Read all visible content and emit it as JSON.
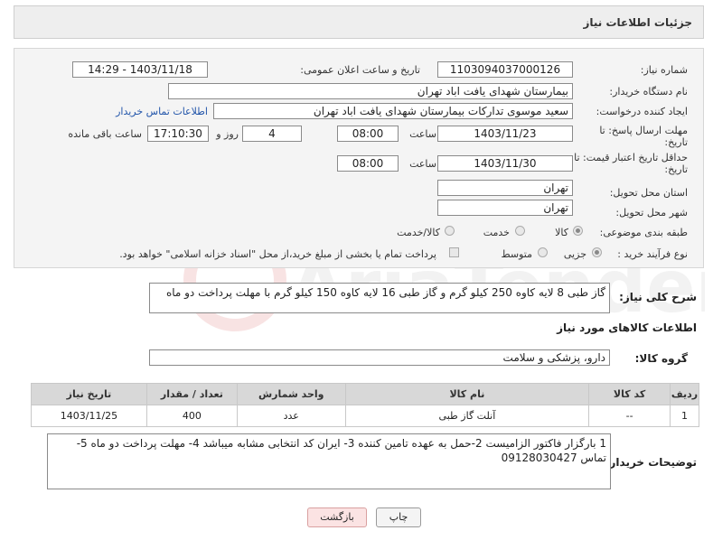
{
  "header": {
    "title": "جزئیات اطلاعات نیاز"
  },
  "form": {
    "need_number": {
      "label": "شماره نیاز:",
      "value": "1103094037000126"
    },
    "announce_datetime": {
      "label": "تاریخ و ساعت اعلان عمومی:",
      "value": "1403/11/18 - 14:29"
    },
    "buyer_org": {
      "label": "نام دستگاه خریدار:",
      "value": "بیمارستان شهدای یافت اباد تهران"
    },
    "requester": {
      "label": "ایجاد کننده درخواست:",
      "value": "سعید موسوی تدارکات بیمارستان شهدای یافت اباد تهران",
      "contact_link": "اطلاعات تماس خریدار"
    },
    "reply_deadline": {
      "label_line1": "مهلت ارسال پاسخ: تا",
      "label_line2": "تاریخ:",
      "date": "1403/11/23",
      "time_label": "ساعت",
      "time": "08:00",
      "days": "4",
      "days_label": "روز و",
      "remaining": "17:10:30",
      "remaining_label": "ساعت باقی مانده"
    },
    "price_validity": {
      "label_line1": "حداقل تاریخ اعتبار قیمت: تا",
      "label_line2": "تاریخ:",
      "date": "1403/11/30",
      "time_label": "ساعت",
      "time": "08:00"
    },
    "province": {
      "label": "استان محل تحویل:",
      "value": "تهران"
    },
    "city": {
      "label": "شهر محل تحویل:",
      "value": "تهران"
    },
    "category": {
      "label": "طبقه بندی موضوعی:",
      "options": [
        "کالا",
        "خدمت",
        "کالا/خدمت"
      ],
      "selected": "کالا"
    },
    "purchase_type": {
      "label": "نوع فرآیند خرید :",
      "options": [
        "جزیی",
        "متوسط"
      ],
      "selected": "جزیی",
      "payment_note": "پرداخت تمام یا بخشی از مبلغ خرید،از محل \"اسناد خزانه اسلامی\" خواهد بود."
    }
  },
  "description": {
    "label": "شرح کلی نیاز:",
    "value": "گاز طبی 8 لایه کاوه 250 کیلو گرم و گاز طبی 16 لایه کاوه 150 کیلو گرم  با مهلت پرداخت دو ماه"
  },
  "goods_info": {
    "title": "اطلاعات کالاهای مورد نیاز",
    "group_label": "گروه کالا:",
    "group_value": "دارو، پزشکی و سلامت",
    "columns": [
      "ردیف",
      "کد کالا",
      "نام کالا",
      "واحد شمارش",
      "تعداد / مقدار",
      "تاریخ نیاز"
    ],
    "rows": [
      [
        "1",
        "--",
        "آنلت گاز طبی",
        "عدد",
        "400",
        "1403/11/25"
      ]
    ]
  },
  "buyer_notes": {
    "label": "توضیحات خریدار:",
    "value": "1 بارگزار فاکتور الزامیست 2-حمل به  عهده تامین کننده 3- ایران کد انتخابی مشابه میباشد 4- مهلت پرداخت دو ماه 5- تماس 09128030427"
  },
  "buttons": {
    "print": "چاپ",
    "back": "بازگشت"
  },
  "watermark": "AriaTender.neT"
}
